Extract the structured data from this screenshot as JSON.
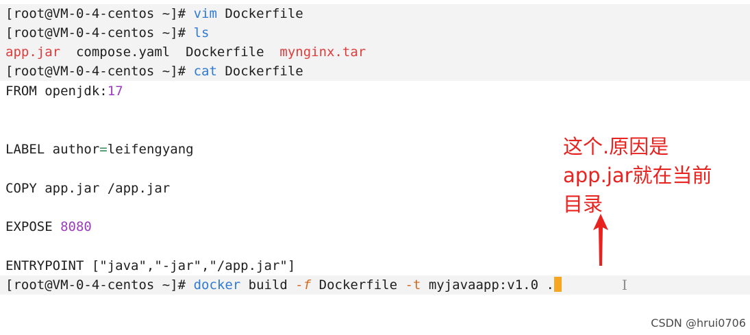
{
  "terminal": {
    "prompt": "[root@VM-0-4-centos ~]#",
    "lines": [
      {
        "cmd": "vim",
        "arg": "Dockerfile"
      },
      {
        "cmd": "ls"
      },
      {
        "files_red": [
          "app.jar",
          "mynginx.tar"
        ],
        "files_plain": [
          "compose.yaml",
          "Dockerfile"
        ]
      },
      {
        "cmd": "cat",
        "arg": "Dockerfile"
      }
    ],
    "dockerfile": {
      "from_kw": "FROM",
      "from_image": "openjdk",
      "from_sep": ":",
      "from_tag": "17",
      "label_kw": "LABEL",
      "label_key": "author",
      "label_eq": "=",
      "label_val": "leifengyang",
      "copy_kw": "COPY",
      "copy_args": "app.jar /app.jar",
      "expose_kw": "EXPOSE",
      "expose_port": "8080",
      "entry_kw": "ENTRYPOINT",
      "entry_args": "[\"java\",\"-jar\",\"/app.jar\"]"
    },
    "build": {
      "cmd": "docker",
      "sub": "build",
      "flag_f": "-f",
      "file": "Dockerfile",
      "flag_t": "-t",
      "image": "myjavaapp",
      "image_sep": ":",
      "tag": "v1.0",
      "context": "."
    },
    "ibeam": "I"
  },
  "annotation": {
    "text": "这个.原因是\napp.jar就在当前\n目录"
  },
  "watermark": "CSDN @hrui0706",
  "colors": {
    "prompt": "#1e1e1e",
    "command": "#2f7ad2",
    "executable_file": "#e03b3b",
    "number": "#9b3bbf",
    "flag": "#d26a1f",
    "annotation": "#e8231f",
    "cursor": "#f5a623"
  }
}
